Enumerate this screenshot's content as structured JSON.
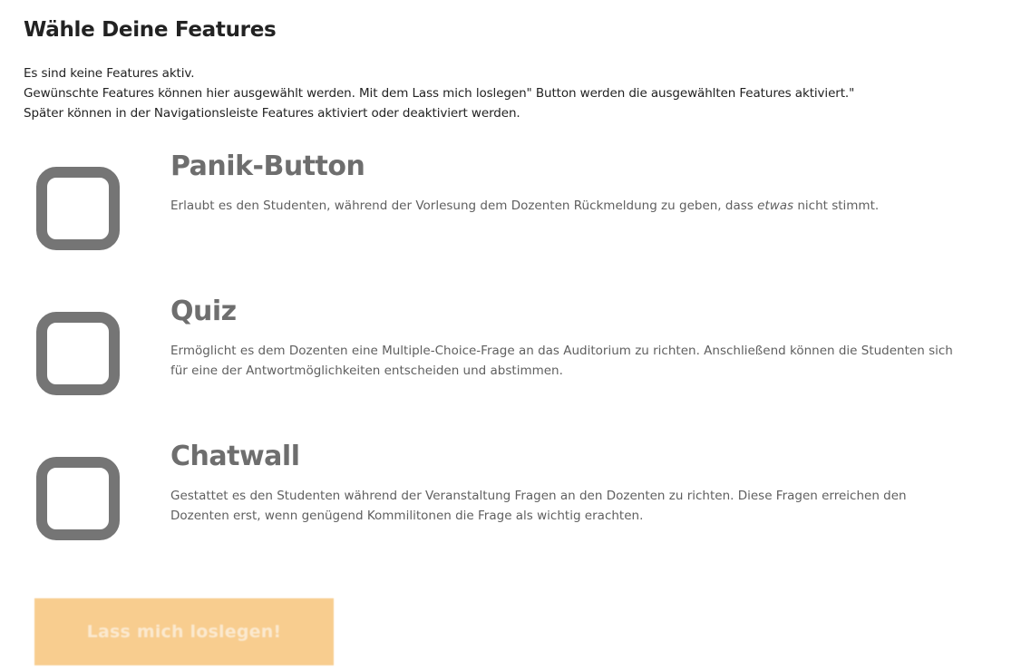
{
  "page": {
    "title": "Wähle Deine Features"
  },
  "intro": {
    "line1": "Es sind keine Features aktiv.",
    "line2": "Gewünschte Features können hier ausgewählt werden. Mit dem Lass mich loslegen\" Button werden die ausgewählten Features aktiviert.\"",
    "line3": "Später können in der Navigationsleiste Features aktiviert oder deaktiviert werden."
  },
  "features": [
    {
      "title": "Panik-Button",
      "desc_before": "Erlaubt es den Studenten, während der Vorlesung dem Dozenten Rückmeldung zu geben, dass ",
      "desc_emphasis": "etwas",
      "desc_after": " nicht stimmt.",
      "checked": false
    },
    {
      "title": "Quiz",
      "desc": "Ermöglicht es dem Dozenten eine Multiple-Choice-Frage an das Auditorium zu richten. Anschließend können die Studenten sich für eine der Antwortmöglichkeiten entscheiden und abstimmen.",
      "checked": false
    },
    {
      "title": "Chatwall",
      "desc": "Gestattet es den Studenten während der Veranstaltung Fragen an den Dozenten zu richten. Diese Fragen erreichen den Dozenten erst, wenn genügend Kommilitonen die Frage als wichtig erachten.",
      "checked": false
    }
  ],
  "start_button": {
    "label": "Lass mich loslegen!",
    "disabled": true
  },
  "colors": {
    "checkbox_border": "#757575",
    "feature_title": "#6e6e6e",
    "button_bg": "#f8cd8f",
    "button_text": "#fbe9cf"
  }
}
